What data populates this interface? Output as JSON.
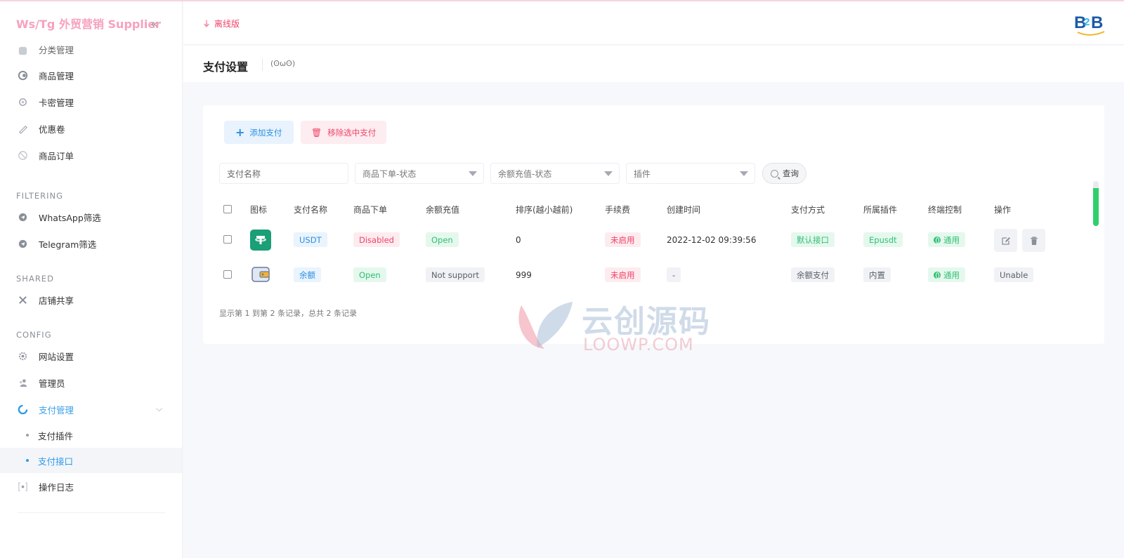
{
  "brand": {
    "title": "Ws/Tg 外贸营销 Supplier",
    "collapse_icon": "«"
  },
  "sidebar": {
    "partial_item": "分类管理",
    "items_top": [
      {
        "label": "商品管理",
        "icon": "box-icon"
      },
      {
        "label": "卡密管理",
        "icon": "key-icon"
      },
      {
        "label": "优惠卷",
        "icon": "coupon-icon"
      },
      {
        "label": "商品订单",
        "icon": "order-icon"
      }
    ],
    "section_filtering": "FILTERING",
    "items_filtering": [
      {
        "label": "WhatsApp筛选"
      },
      {
        "label": "Telegram筛选"
      }
    ],
    "section_shared": "SHARED",
    "items_shared": [
      {
        "label": "店铺共享"
      }
    ],
    "section_config": "CONFIG",
    "items_config": [
      {
        "label": "网站设置"
      },
      {
        "label": "管理员"
      },
      {
        "label": "支付管理"
      }
    ],
    "sub_items": [
      {
        "label": "支付插件"
      },
      {
        "label": "支付接口"
      }
    ],
    "item_log": "操作日志"
  },
  "header": {
    "offline_label": "离线版"
  },
  "page": {
    "title": "支付设置",
    "emote": "(ʘωʘ)"
  },
  "toolbar": {
    "add_label": "添加支付",
    "remove_label": "移除选中支付"
  },
  "filters": {
    "name_placeholder": "支付名称",
    "order_status": "商品下单-状态",
    "balance_status": "余额充值-状态",
    "plugin": "插件",
    "query_label": "查询"
  },
  "table": {
    "headers": [
      "图标",
      "支付名称",
      "商品下单",
      "余额充值",
      "排序(越小越前)",
      "手续费",
      "创建时间",
      "支付方式",
      "所属插件",
      "终端控制",
      "操作"
    ],
    "rows": [
      {
        "icon": "tether-icon",
        "name": "USDT",
        "order": "Disabled",
        "balance": "Open",
        "sort": "0",
        "fee": "未启用",
        "created": "2022-12-02 09:39:56",
        "method": "默认接口",
        "plugin": "Epusdt",
        "terminal": "通用",
        "action": ""
      },
      {
        "icon": "wallet-icon",
        "name": "余额",
        "order": "Open",
        "balance": "Not support",
        "sort": "999",
        "fee": "未启用",
        "created": "-",
        "method": "余额支付",
        "plugin": "内置",
        "terminal": "通用",
        "action": "Unable"
      }
    ],
    "footer": "显示第 1 到第 2 条记录，总共 2 条记录"
  },
  "watermark": {
    "cn": "云创源码",
    "en": "LOOWP.COM"
  },
  "colors": {
    "accent": "#2e9be9",
    "brand_pink": "#f7a1bd",
    "danger": "#f04468",
    "success": "#2fbf71"
  }
}
